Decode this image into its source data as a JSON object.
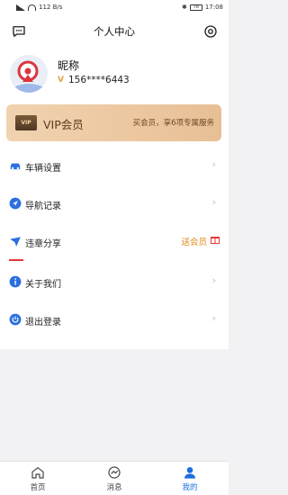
{
  "status_bar": {
    "network": "112 B/s",
    "battery": "78",
    "time": "17:08"
  },
  "header": {
    "title": "个人中心"
  },
  "profile": {
    "nickname": "昵称",
    "phone": "156****6443",
    "vmark": "V"
  },
  "vip": {
    "badge": "VIP",
    "title": "VIP会员",
    "desc": "买会员，享6项专属服务"
  },
  "menu": {
    "items": [
      {
        "label": "车辆设置",
        "icon": "car-icon"
      },
      {
        "label": "导航记录",
        "icon": "navigation-icon"
      },
      {
        "label": "违章分享",
        "icon": "share-icon",
        "promo": "送会员"
      },
      {
        "label": "关于我们",
        "icon": "info-icon"
      },
      {
        "label": "退出登录",
        "icon": "power-icon"
      }
    ],
    "chevron": "›"
  },
  "tabs": [
    {
      "label": "首页",
      "icon": "home-icon",
      "active": false
    },
    {
      "label": "消息",
      "icon": "message-icon",
      "active": false
    },
    {
      "label": "我的",
      "icon": "user-icon",
      "active": true
    }
  ],
  "colors": {
    "accent": "#1e6fe0",
    "promo": "#e08a1e",
    "vip_gradient_start": "#f1d3b0",
    "vip_gradient_end": "#e8bf95"
  }
}
